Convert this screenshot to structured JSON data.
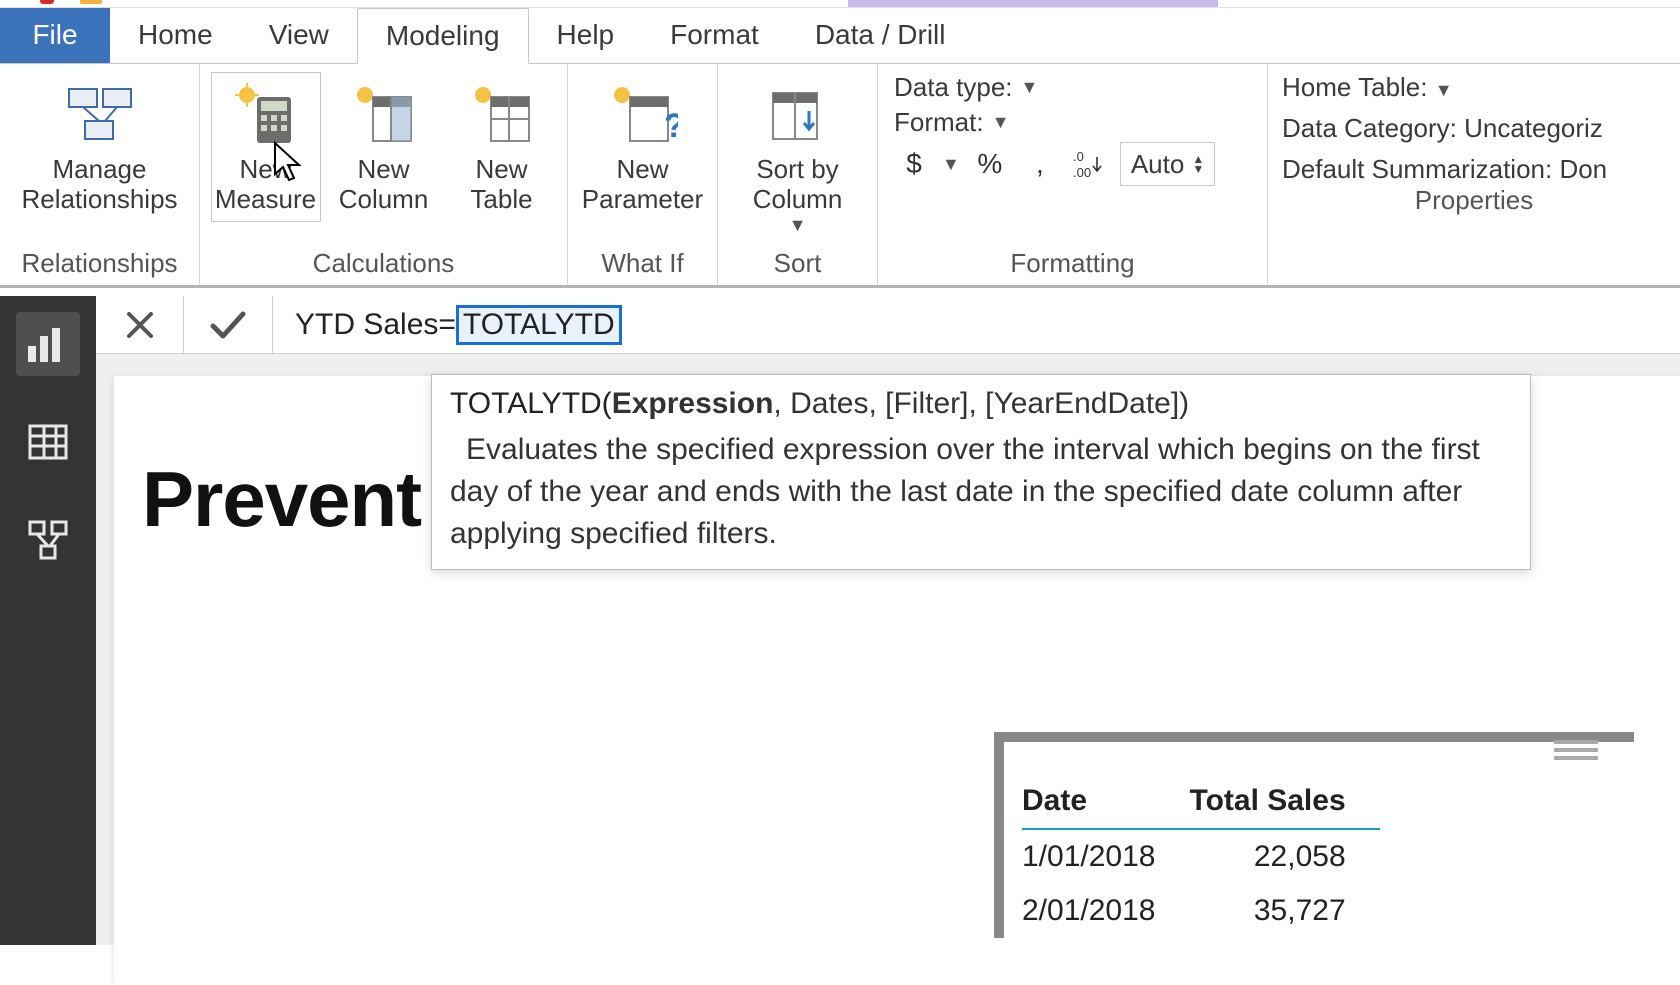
{
  "tabs": {
    "file": "File",
    "home": "Home",
    "view": "View",
    "modeling": "Modeling",
    "help": "Help",
    "format": "Format",
    "data_drill": "Data / Drill"
  },
  "ribbon": {
    "relationships": {
      "manage": "Manage\nRelationships",
      "group": "Relationships"
    },
    "calculations": {
      "new_measure": "New\nMeasure",
      "new_column": "New\nColumn",
      "new_table": "New\nTable",
      "group": "Calculations"
    },
    "whatif": {
      "new_parameter": "New\nParameter",
      "group": "What If"
    },
    "sort": {
      "sort_by_column": "Sort by\nColumn",
      "group": "Sort"
    },
    "formatting": {
      "data_type_label": "Data type:",
      "format_label": "Format:",
      "currency": "$",
      "percent": "%",
      "comma": ",",
      "decimals_icon": ".0 .00",
      "auto": "Auto",
      "group": "Formatting"
    },
    "properties": {
      "home_table_label": "Home Table:",
      "data_category_label": "Data Category: Uncategoriz",
      "default_sum_label": "Default Summarization: Don",
      "group": "Properties"
    }
  },
  "formula": {
    "measure_name": "YTD Sales",
    "eq": " = ",
    "token": "TOTALYTD"
  },
  "intellisense": {
    "fname": "TOTALYTD(",
    "arg_bold": "Expression",
    "rest": ", Dates, [Filter], [YearEndDate])",
    "desc": "Evaluates the specified expression over the interval which begins on the first day of the year and ends with the last date in the specified date column after applying specified filters."
  },
  "page": {
    "title": "Prevent YTD Results Projecting Forw"
  },
  "visual": {
    "headers": [
      "Date",
      "Total Sales"
    ],
    "rows": [
      {
        "date": "1/01/2018",
        "val": "22,058"
      },
      {
        "date": "2/01/2018",
        "val": "35,727"
      }
    ]
  }
}
